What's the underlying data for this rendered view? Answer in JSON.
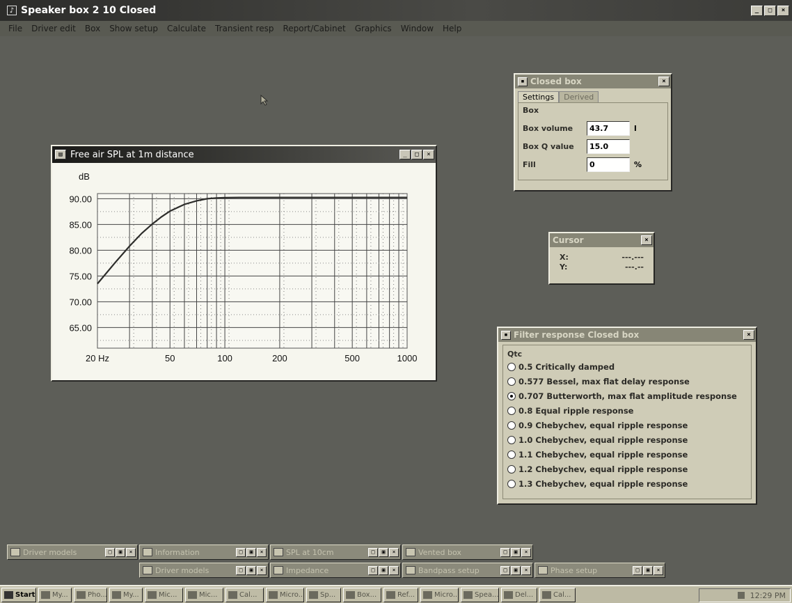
{
  "app": {
    "title": "Speaker box 2 10 Closed",
    "icon": "speaker-app-icon"
  },
  "menu": [
    "File",
    "Driver edit",
    "Box",
    "Show setup",
    "Calculate",
    "Transient resp",
    "Report/Cabinet",
    "Graphics",
    "Window",
    "Help"
  ],
  "spl_window": {
    "title": "Free air SPL at 1m distance",
    "y_unit": "dB"
  },
  "chart_data": {
    "type": "line",
    "title": "Free air SPL at 1m distance",
    "ylabel": "dB",
    "xlabel": "",
    "x_scale": "log",
    "xlim": [
      20,
      1000
    ],
    "ylim": [
      61,
      91
    ],
    "x_ticks": [
      20,
      50,
      100,
      200,
      500,
      1000
    ],
    "x_tick_labels": [
      "20 Hz",
      "50",
      "100",
      "200",
      "500",
      "1000"
    ],
    "y_ticks": [
      90,
      85,
      80,
      75,
      70,
      65
    ],
    "y_tick_labels": [
      "90.00",
      "85.00",
      "80.00",
      "75.00",
      "70.00",
      "65.00"
    ],
    "grid": true,
    "series": [
      {
        "color": "#2d2d2b",
        "x": [
          20,
          25,
          30,
          35,
          40,
          45,
          50,
          60,
          70,
          80,
          90,
          100,
          120,
          150,
          200,
          300,
          500,
          1000
        ],
        "y": [
          73.5,
          77.6,
          80.8,
          83.3,
          85.1,
          86.5,
          87.6,
          88.9,
          89.6,
          90.0,
          90.15,
          90.2,
          90.25,
          90.25,
          90.25,
          90.25,
          90.25,
          90.25
        ]
      }
    ]
  },
  "closed_box": {
    "title": "Closed box",
    "tabs": [
      "Settings",
      "Derived"
    ],
    "group": "Box",
    "fields": [
      {
        "label": "Box volume",
        "value": "43.7",
        "unit": "l"
      },
      {
        "label": "Box Q value",
        "value": "15.0",
        "unit": ""
      },
      {
        "label": "Fill",
        "value": "0",
        "unit": "%"
      }
    ]
  },
  "cursor": {
    "title": "Cursor",
    "x_label": "X:",
    "x_value": "---.---",
    "y_label": "Y:",
    "y_value": "---.--"
  },
  "filter": {
    "title": "Filter response Closed box",
    "group": "Qtc",
    "options": [
      {
        "label": "0.5 Critically damped",
        "selected": false
      },
      {
        "label": "0.577 Bessel, max flat delay response",
        "selected": false
      },
      {
        "label": "0.707 Butterworth, max flat amplitude response",
        "selected": true
      },
      {
        "label": "0.8 Equal ripple response",
        "selected": false
      },
      {
        "label": "0.9 Chebychev, equal ripple response",
        "selected": false
      },
      {
        "label": "1.0 Chebychev, equal ripple response",
        "selected": false
      },
      {
        "label": "1.1 Chebychev, equal ripple response",
        "selected": false
      },
      {
        "label": "1.2 Chebychev, equal ripple response",
        "selected": false
      },
      {
        "label": "1.3 Chebychev, equal ripple response",
        "selected": false
      }
    ]
  },
  "minimized": [
    "Driver models",
    "Information",
    "SPL at 10cm",
    "Vented box",
    "Driver models",
    "Impedance",
    "Bandpass setup",
    "Phase setup"
  ],
  "taskbar": {
    "start": "Start",
    "buttons": [
      "My...",
      "Pho...",
      "My...",
      "Mic...",
      "Mic...",
      "Cal...",
      "Micro...",
      "Sp...",
      "Box...",
      "Ref...",
      "Micro...",
      "Spea...",
      "Del...",
      "Cal..."
    ],
    "clock": "12:29 PM"
  }
}
